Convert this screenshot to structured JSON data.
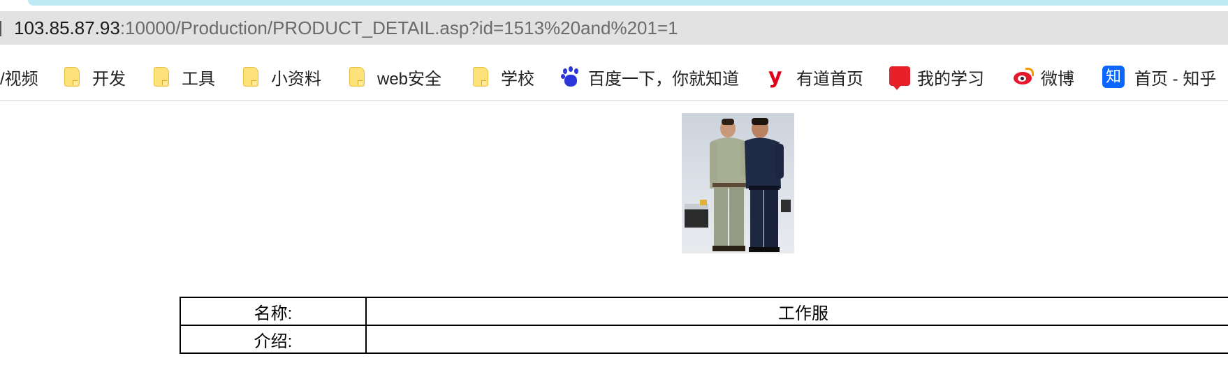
{
  "browser": {
    "address_bar": {
      "host": "103.85.87.93",
      "path": ":10000/Production/PRODUCT_DETAIL.asp?id=1513%20and%201=1"
    },
    "bookmarks": [
      {
        "label": "/视频",
        "icon": "none"
      },
      {
        "label": "开发",
        "icon": "folder-icon"
      },
      {
        "label": "工具",
        "icon": "folder-icon"
      },
      {
        "label": "小资料",
        "icon": "folder-icon"
      },
      {
        "label": "web安全",
        "icon": "folder-icon"
      },
      {
        "label": "学校",
        "icon": "folder-icon"
      },
      {
        "label": "百度一下，你就知道",
        "icon": "baidu-icon"
      },
      {
        "label": "有道首页",
        "icon": "youdao-icon"
      },
      {
        "label": "我的学习",
        "icon": "study-icon"
      },
      {
        "label": "微博",
        "icon": "weibo-icon"
      },
      {
        "label": "首页 - 知乎",
        "icon": "zhihu-icon"
      }
    ],
    "zhihu_glyph": "知",
    "youdao_glyph": "y"
  },
  "page": {
    "product_image": {
      "description": "product-photo"
    },
    "table": {
      "rows": [
        {
          "label": "名称:",
          "value": "工作服"
        },
        {
          "label": "介绍:",
          "value": ""
        }
      ]
    }
  },
  "colors": {
    "tab_accent": "#bfe9f5",
    "address_bar_bg": "#e2e2e2",
    "folder_yellow": "#fde27c",
    "baidu_blue": "#2b36d9",
    "youdao_red": "#e3001b",
    "weibo_red": "#e6162d",
    "zhihu_blue": "#0a66ff"
  }
}
